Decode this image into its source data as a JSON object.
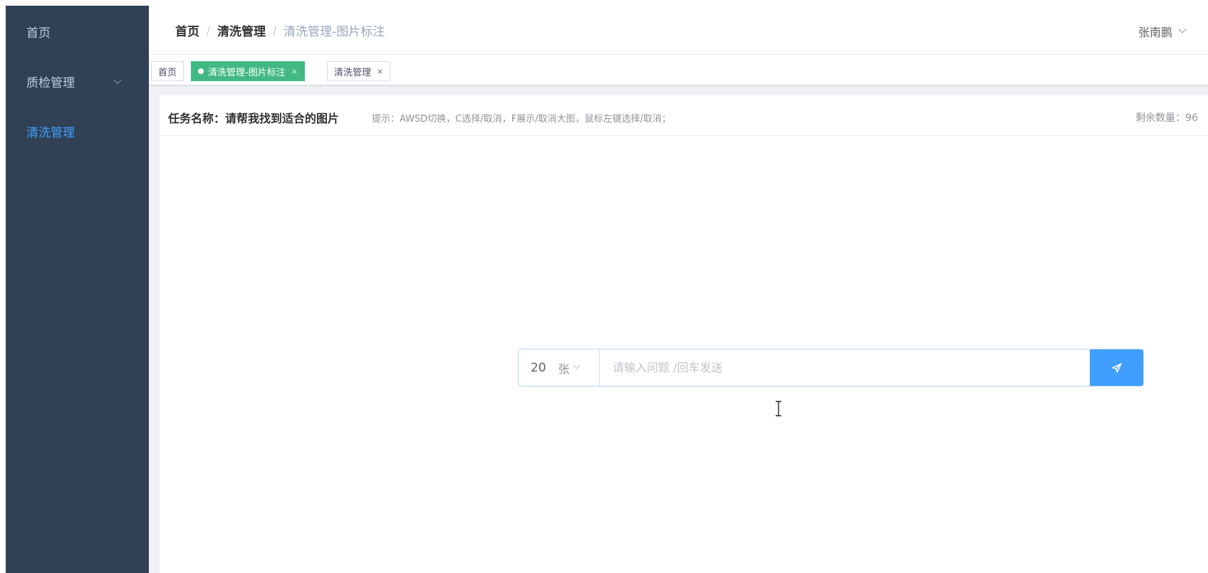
{
  "sidebar": {
    "items": [
      {
        "label": "首页"
      },
      {
        "label": "质检管理"
      },
      {
        "label": "清洗管理"
      }
    ]
  },
  "navbar": {
    "breadcrumb": [
      "首页",
      "清洗管理",
      "清洗管理-图片标注"
    ],
    "separator": "/",
    "user_name": "张南鹏"
  },
  "tags": [
    {
      "label": "首页"
    },
    {
      "label": "清洗管理-图片标注",
      "close": "×"
    },
    {
      "label": "清洗管理",
      "close": "×"
    }
  ],
  "task": {
    "name_label": "任务名称：请帮我找到适合的图片",
    "hint": "提示：AWSD切换，C选择/取消，F展示/取消大图，鼠标左键选择/取消；",
    "remaining": "剩余数量：96"
  },
  "chat": {
    "count": "20",
    "unit": "张",
    "placeholder": "请输入问题 /回车发送"
  },
  "colors": {
    "sidebar_bg": "#304156",
    "active_menu": "#409eff",
    "active_tag": "#42b983",
    "send_button": "#409eff"
  },
  "icons": {
    "send": "send-icon",
    "dropdown": "chevron-down-icon",
    "tag_close": "close-icon"
  }
}
